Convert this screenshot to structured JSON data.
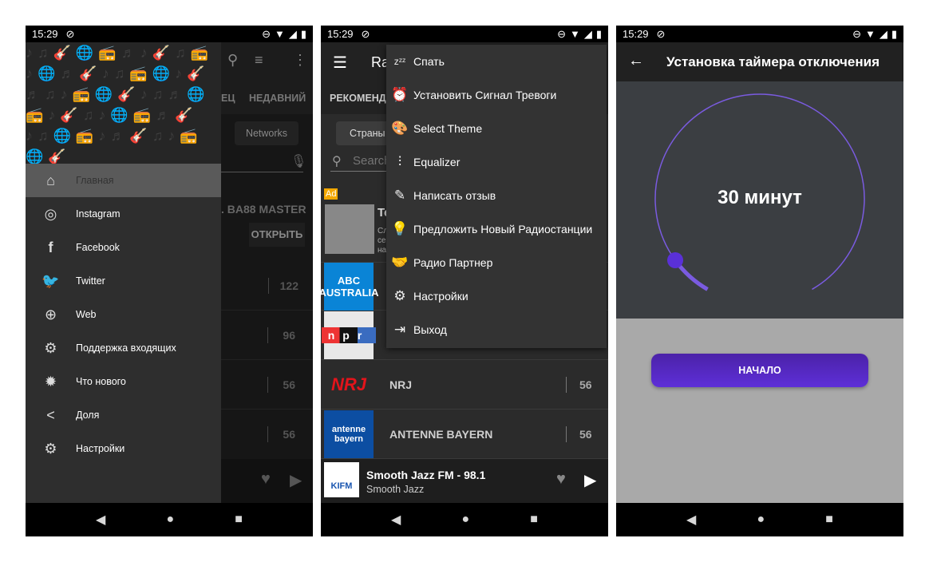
{
  "status": {
    "time": "15:29",
    "icons": [
      "dnd-icon",
      "wifi-icon",
      "signal-icon",
      "battery-icon"
    ]
  },
  "phone1": {
    "drawer": {
      "items": [
        {
          "label": "Главная",
          "icon": "home-icon",
          "selected": true
        },
        {
          "label": "Instagram",
          "icon": "instagram-icon"
        },
        {
          "label": "Facebook",
          "icon": "facebook-icon"
        },
        {
          "label": "Twitter",
          "icon": "twitter-icon"
        },
        {
          "label": "Web",
          "icon": "globe-icon"
        },
        {
          "label": "Поддержка входящих",
          "icon": "support-icon"
        },
        {
          "label": "Что нового",
          "icon": "alert-icon"
        },
        {
          "label": "Доля",
          "icon": "share-icon"
        },
        {
          "label": "Настройки",
          "icon": "settings-icon"
        }
      ]
    },
    "bg": {
      "tab_partial": "ЕЦ",
      "tab_recent": "НЕДАВНИЙ",
      "chip": "Networks",
      "ad_title": ". BA88 MASTER",
      "ad_button": "ОТКРЫТЬ",
      "counts": [
        "122",
        "96",
        "56",
        "56"
      ]
    }
  },
  "phone2": {
    "title_partial": "Ra",
    "tab_partial": "РЕКОМЕНДУ",
    "chip": "Страны",
    "search_placeholder": "Search",
    "ad": {
      "badge": "Ad",
      "title_partial": "Te",
      "lines": [
        "Сл",
        "се",
        "на"
      ]
    },
    "menu": [
      {
        "label": "Спать",
        "icon": "sleep-icon"
      },
      {
        "label": "Установить Сигнал Тревоги",
        "icon": "alarm-icon"
      },
      {
        "label": "Select Theme",
        "icon": "palette-icon"
      },
      {
        "label": "Equalizer",
        "icon": "equalizer-icon"
      },
      {
        "label": "Написать отзыв",
        "icon": "edit-icon"
      },
      {
        "label": "Предложить Новый Радиостанции",
        "icon": "lightbulb-icon"
      },
      {
        "label": "Радио Партнер",
        "icon": "handshake-icon"
      },
      {
        "label": "Настройки",
        "icon": "settings-icon"
      },
      {
        "label": "Выход",
        "icon": "exit-icon"
      }
    ],
    "stations": [
      {
        "logo": "ABC AUSTRALIA",
        "logo_bg": "#0a84d6"
      },
      {
        "logo": "npr",
        "logo_bg": "#e8e8e8"
      },
      {
        "name": "NRJ",
        "count": "56",
        "logo": "NRJ",
        "logo_bg": "#2b2b2b"
      },
      {
        "name": "ANTENNE BAYERN",
        "count": "56",
        "logo": "antenne bayern",
        "logo_bg": "#0c4ea2"
      }
    ],
    "player": {
      "title": "Smooth Jazz FM - 98.1",
      "subtitle": "Smooth Jazz",
      "logo": "KIFM"
    }
  },
  "phone3": {
    "title": "Установка таймера отключения",
    "value": "30 минут",
    "progress_fraction": 0.08,
    "start_button": "НАЧАЛО",
    "accent": "#7a5be0"
  }
}
